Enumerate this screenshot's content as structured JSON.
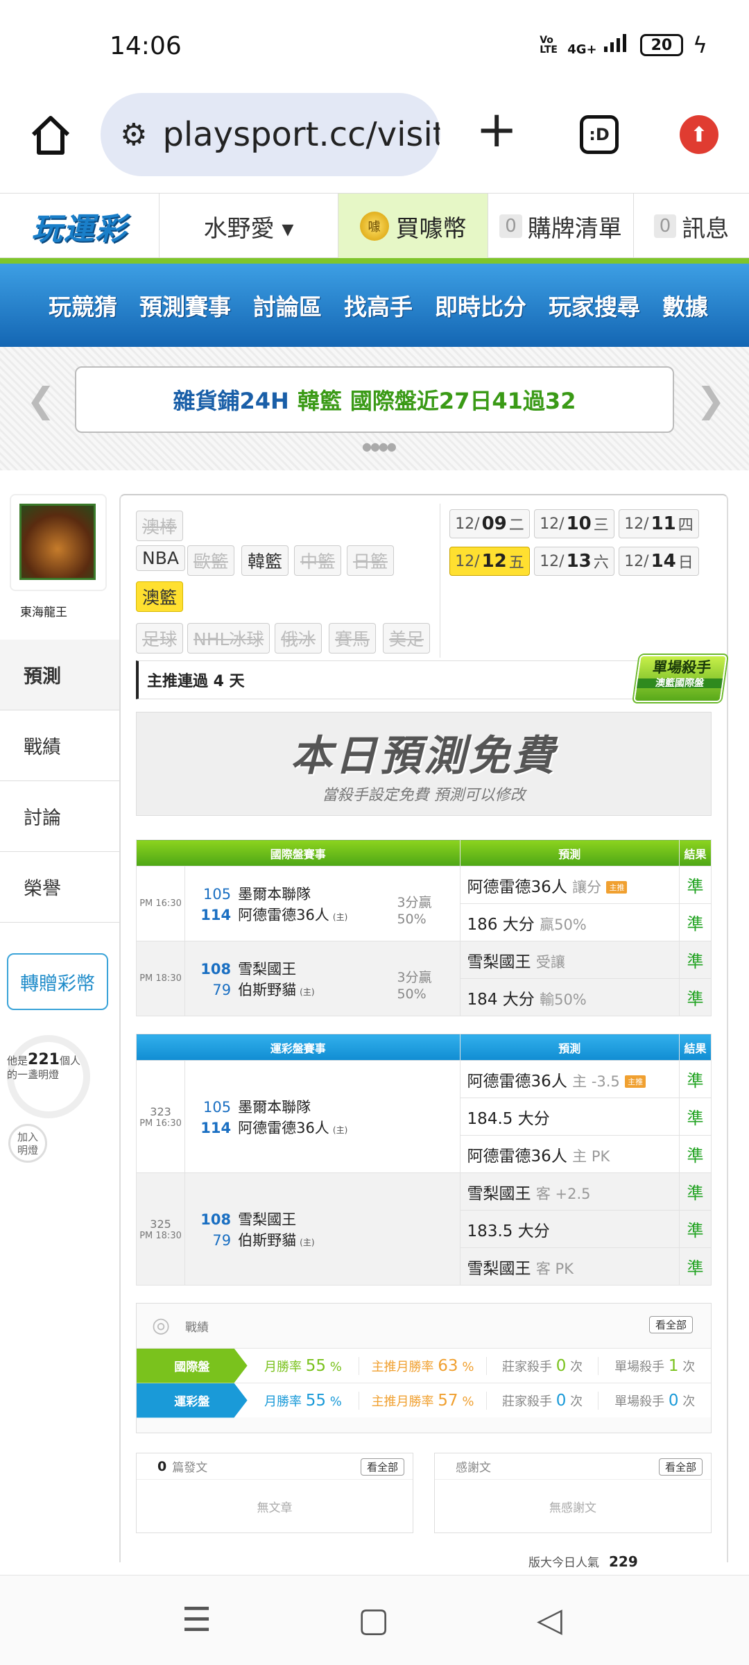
{
  "status": {
    "time": "14:06",
    "volte": "Vo LTE",
    "net": "4G+",
    "battery": "20"
  },
  "browser": {
    "url": "playsport.cc/visit"
  },
  "header": {
    "logo": "玩運彩",
    "user": "水野愛 ▾",
    "buy": "買噱幣",
    "buy_coin": "噱",
    "cart_count": "0",
    "cart": "購牌清單",
    "msg_count": "0",
    "msg": "訊息"
  },
  "nav": [
    "玩競猜",
    "預測賽事",
    "討論區",
    "找高手",
    "即時比分",
    "玩家搜尋",
    "數據"
  ],
  "banner": {
    "part1": "雜貨鋪24H",
    "part2": "韓籃",
    "part3": "國際盤近27日41過32"
  },
  "sidebar": {
    "avatar_name": "東海龍王",
    "menu": [
      "預測",
      "戰績",
      "討論",
      "榮譽"
    ],
    "gift": "轉贈彩幣",
    "lamp_pre": "他是",
    "lamp_num": "221",
    "lamp_post": "個人",
    "lamp_line2": "的一盞明燈",
    "join_l1": "加入",
    "join_l2": "明燈"
  },
  "leagues": {
    "r0": [
      "澳棒"
    ],
    "r1": [
      "NBA",
      "歐籃",
      "韓籃",
      "中籃",
      "日籃"
    ],
    "r2": [
      "澳籃"
    ],
    "r3": [
      "足球",
      "NHL冰球",
      "俄冰",
      "賽馬",
      "美足"
    ]
  },
  "dates": [
    [
      "12/",
      "09",
      "二"
    ],
    [
      "12/",
      "10",
      "三"
    ],
    [
      "12/",
      "11",
      "四"
    ],
    [
      "12/",
      "12",
      "五"
    ],
    [
      "12/",
      "13",
      "六"
    ],
    [
      "12/",
      "14",
      "日"
    ]
  ],
  "streak": "主推連過 4 天",
  "badge": {
    "title": "單場殺手",
    "sub": "澳籃國際盤"
  },
  "free": {
    "title": "本日預測免費",
    "sub": "當殺手設定免費 預測可以修改"
  },
  "intl": {
    "h1": "國際盤賽事",
    "h2": "預測",
    "h3": "結果",
    "g1": {
      "time": "PM 16:30",
      "s1": "105",
      "t1": "墨爾本聯隊",
      "s2": "114",
      "t2": "阿德雷德36人",
      "home": "(主)",
      "note": "3分贏",
      "note2": "50%",
      "p1": "阿德雷德36人",
      "p1b": "讓分",
      "tip": "主推",
      "r1": "準",
      "p2": "186 大分",
      "p2b": "贏50%",
      "r2": "準"
    },
    "g2": {
      "time": "PM 18:30",
      "s1": "108",
      "t1": "雪梨國王",
      "s2": "79",
      "t2": "伯斯野貓",
      "home": "(主)",
      "note": "3分贏",
      "note2": "50%",
      "p1": "雪梨國王",
      "p1b": "受讓",
      "r1": "準",
      "p2": "184 大分",
      "p2b": "輸50%",
      "r2": "準"
    }
  },
  "sport": {
    "h1": "運彩盤賽事",
    "h2": "預測",
    "h3": "結果",
    "g1": {
      "no": "323",
      "time": "PM 16:30",
      "s1": "105",
      "t1": "墨爾本聯隊",
      "s2": "114",
      "t2": "阿德雷德36人",
      "home": "(主)",
      "p1": "阿德雷德36人",
      "p1b": "主 -3.5",
      "tip": "主推",
      "p2": "184.5 大分",
      "p3": "阿德雷德36人",
      "p3b": "主 PK",
      "r": "準"
    },
    "g2": {
      "no": "325",
      "time": "PM 18:30",
      "s1": "108",
      "t1": "雪梨國王",
      "s2": "79",
      "t2": "伯斯野貓",
      "home": "(主)",
      "p1": "雪梨國王",
      "p1b": "客 +2.5",
      "p2": "183.5 大分",
      "p3": "雪梨國王",
      "p3b": "客 PK",
      "r": "準"
    }
  },
  "record": {
    "title": "戰績",
    "all": "看全部",
    "rows": [
      {
        "label": "國際盤",
        "m_lab": "月勝率",
        "m": "55",
        "mp": "%",
        "t_lab": "主推月勝率",
        "t": "63",
        "tp": "%",
        "z_lab": "莊家殺手",
        "z": "0",
        "zu": "次",
        "k_lab": "單場殺手",
        "k": "1",
        "ku": "次"
      },
      {
        "label": "運彩盤",
        "m_lab": "月勝率",
        "m": "55",
        "mp": "%",
        "t_lab": "主推月勝率",
        "t": "57",
        "tp": "%",
        "z_lab": "莊家殺手",
        "z": "0",
        "zu": "次",
        "k_lab": "單場殺手",
        "k": "0",
        "ku": "次"
      }
    ]
  },
  "posts": {
    "count": "0",
    "label": "篇發文",
    "all": "看全部",
    "empty": "無文章"
  },
  "thanks": {
    "label": "感謝文",
    "all": "看全部",
    "empty": "無感謝文"
  },
  "popularity": {
    "label": "版大今日人氣",
    "value": "229"
  }
}
